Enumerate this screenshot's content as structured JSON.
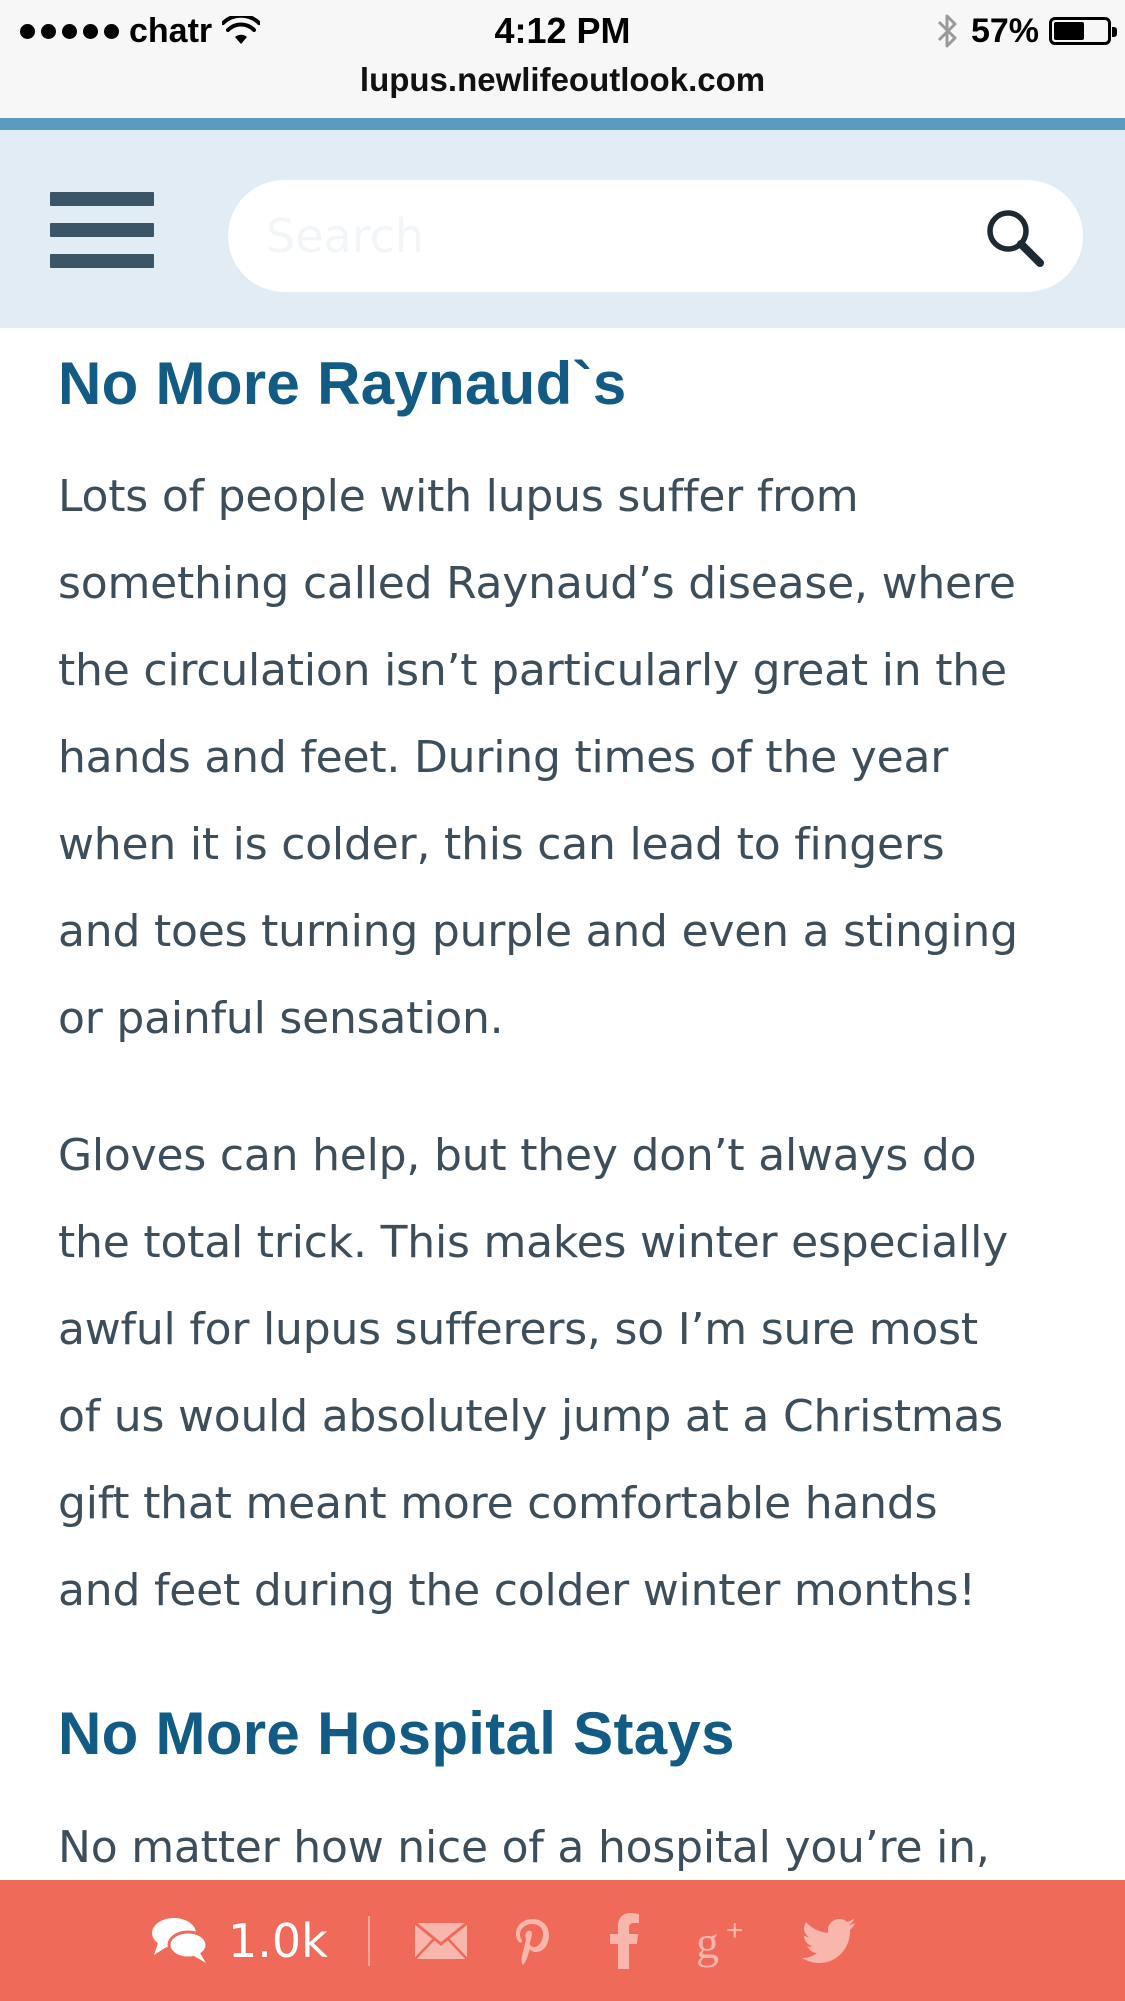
{
  "status_bar": {
    "carrier": "chatr",
    "time": "4:12 PM",
    "battery_percent": "57%",
    "battery_level": 0.57
  },
  "browser": {
    "url": "lupus.newlifeoutlook.com"
  },
  "header": {
    "menu_icon": "hamburger-menu-icon",
    "search_placeholder": "Search",
    "search_icon": "search-icon"
  },
  "article": {
    "section1": {
      "heading": "No More Raynaud`s",
      "paragraph1_lines": [
        "Lots of people with lupus suffer from",
        "something called Raynaud’s disease, where",
        "the circulation isn’t particularly great in the",
        "hands and feet. During times of the year",
        "when it is colder, this can lead to fingers",
        "and toes turning purple and even a stinging",
        "or painful sensation."
      ],
      "paragraph2_lines": [
        "Gloves can help, but they don’t always do",
        "the total trick. This makes winter especially",
        "awful for lupus sufferers, so I’m sure most",
        "of us would absolutely jump at a Christmas",
        "gift that meant more comfortable hands",
        "and feet during the colder winter months!"
      ]
    },
    "section2": {
      "heading": "No More Hospital Stays",
      "paragraph1_lines": [
        "No matter how nice of a hospital you’re in,"
      ]
    }
  },
  "share_bar": {
    "comment_count": "1.0k",
    "icons": [
      "comment-icon",
      "mail-icon",
      "pinterest-icon",
      "facebook-icon",
      "google-plus-icon",
      "twitter-icon"
    ],
    "background_color": "#ef6a59"
  },
  "colors": {
    "heading": "#115b85",
    "body_text": "#3d4e5a",
    "header_bg": "#e2ecf4",
    "accent_line": "#5c9bc0"
  }
}
